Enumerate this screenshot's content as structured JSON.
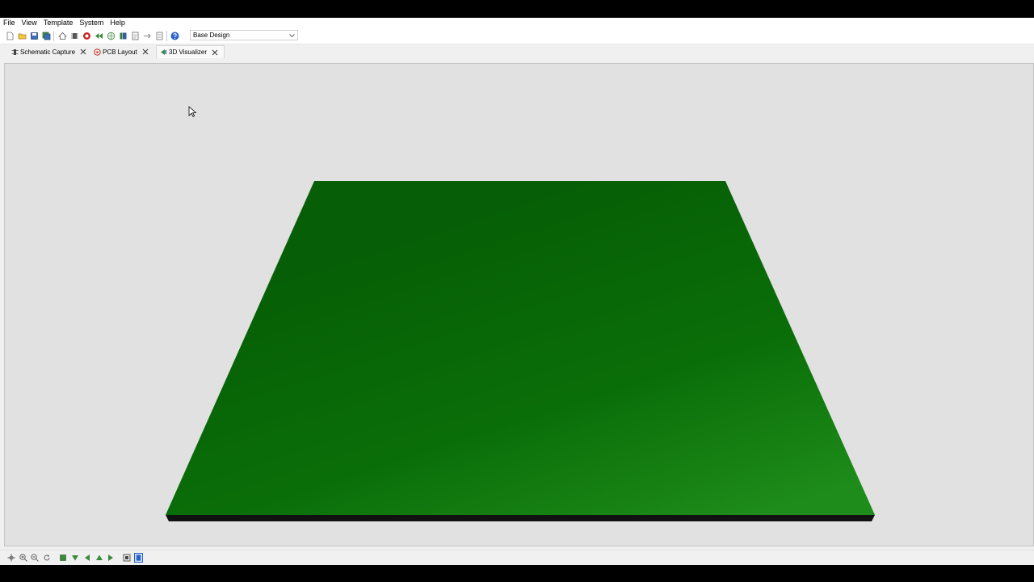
{
  "menu": [
    "File",
    "View",
    "Template",
    "System",
    "Help"
  ],
  "toolbar": {
    "icons": [
      "new-file-icon",
      "open-folder-icon",
      "save-icon",
      "save-all-icon",
      "home-icon",
      "component-icon",
      "record-icon",
      "rewind-icon",
      "globe-icon",
      "library-icon",
      "document-icon",
      "export-icon",
      "notes-icon",
      "help-icon"
    ],
    "design_selector": {
      "value": "Base Design"
    }
  },
  "tabs": [
    {
      "label": "Schematic Capture",
      "icon": "schematic-icon",
      "active": false
    },
    {
      "label": "PCB Layout",
      "icon": "pcb-icon",
      "active": false
    },
    {
      "label": "3D Visualizer",
      "icon": "visualizer-icon",
      "active": true
    }
  ],
  "viewer": {
    "object": "pcb-board",
    "colors": {
      "board_top": "#0a6e08",
      "board_top_light": "#1e8c1a",
      "board_edge": "#111111",
      "background": "#e1e1e1"
    }
  },
  "bottom_toolbar": {
    "icons": [
      "pan-icon",
      "zoom-in-icon",
      "zoom-out-icon",
      "rotate-icon",
      "top-view-icon",
      "bottom-view-icon",
      "left-view-icon",
      "front-view-icon",
      "right-view-icon",
      "fit-view-icon",
      "board-view-icon"
    ]
  },
  "accent": "#2a62c9"
}
